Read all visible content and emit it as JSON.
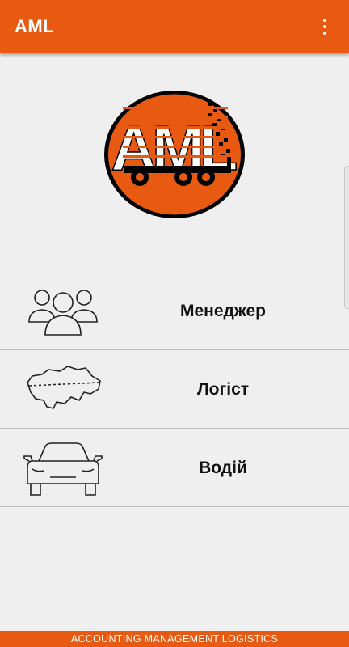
{
  "appbar": {
    "title": "AML",
    "overflow_icon": "more-vert-icon"
  },
  "logo": {
    "text": "AML",
    "colors": {
      "background": "#e85a12",
      "mark": "#000000",
      "letters": "#ffffff"
    }
  },
  "menu": {
    "items": [
      {
        "label": "Менеджер",
        "icon": "people-group-icon"
      },
      {
        "label": "Логіст",
        "icon": "ukraine-map-route-icon"
      },
      {
        "label": "Водій",
        "icon": "car-icon"
      }
    ]
  },
  "footer": {
    "text": "ACCOUNTING MANAGEMENT LOGISTICS"
  },
  "theme": {
    "accent": "#e85a12",
    "background": "#efefef",
    "divider": "#bdbdbd"
  }
}
